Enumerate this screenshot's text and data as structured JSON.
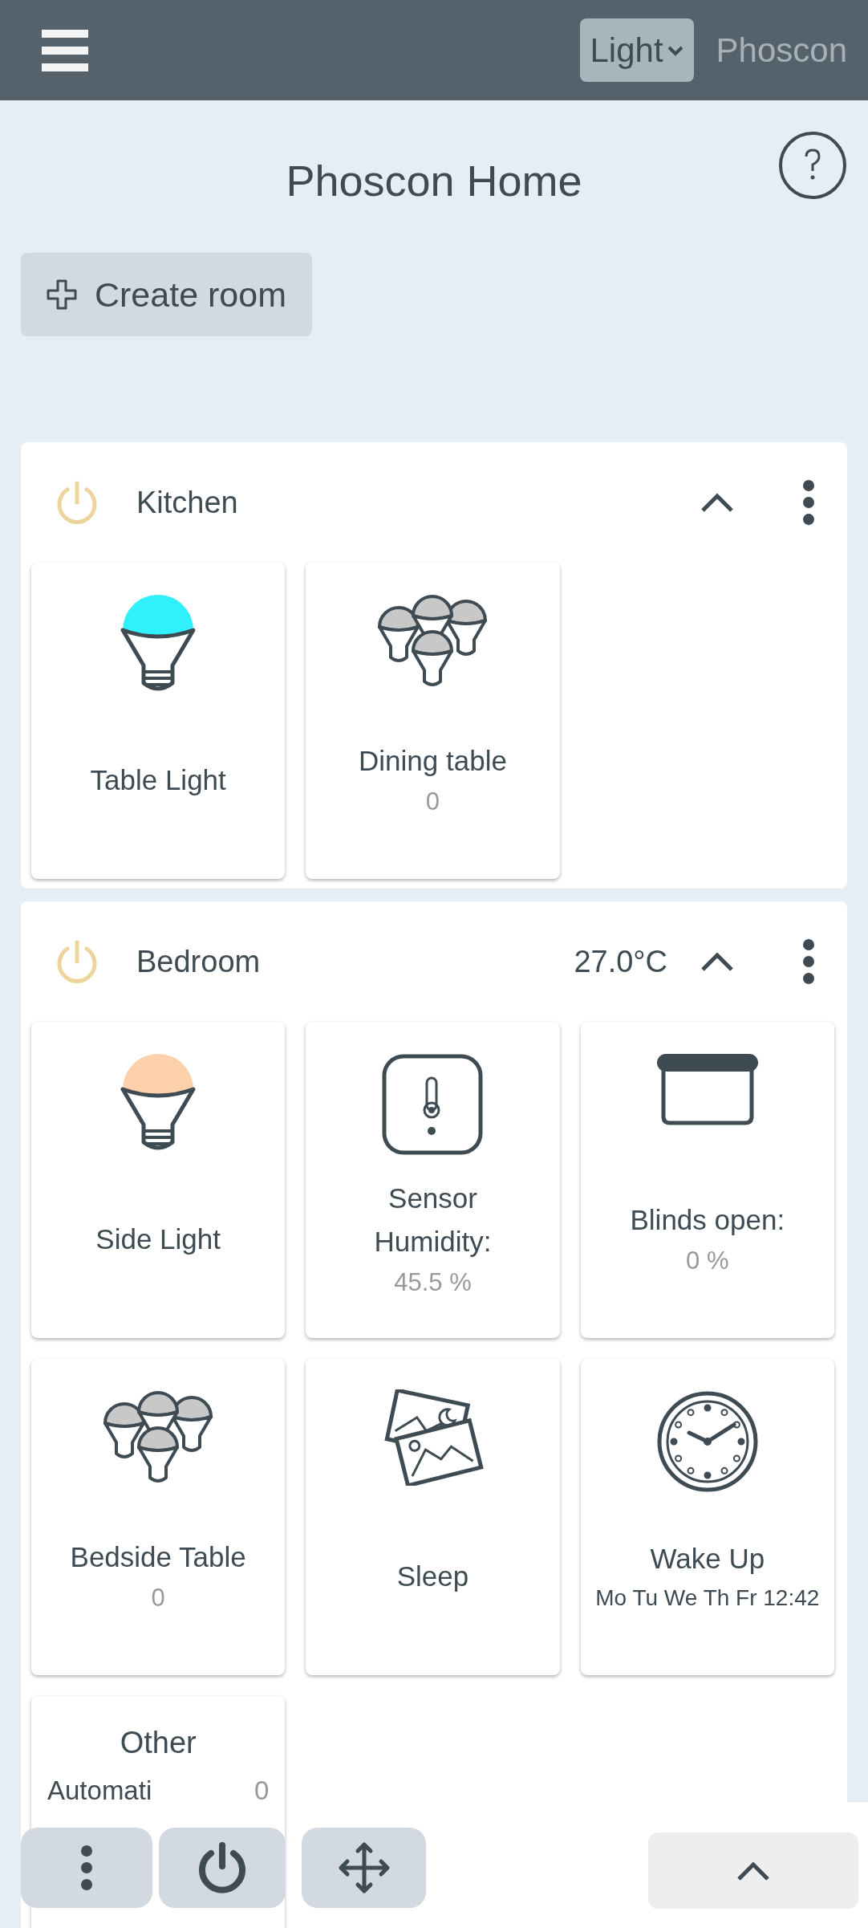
{
  "top_bar": {
    "theme_select": "Light",
    "brand": "Phoscon"
  },
  "title": "Phoscon Home",
  "create_button": "Create room",
  "rooms": [
    {
      "name": "Kitchen",
      "on": false,
      "expanded": true,
      "tiles": [
        {
          "kind": "light",
          "name": "Table Light",
          "color": "#2ff0fb"
        },
        {
          "kind": "group",
          "name": "Dining table",
          "value": "0"
        }
      ]
    },
    {
      "name": "Bedroom",
      "on": false,
      "temperature": "27.0°C",
      "expanded": true,
      "tiles": [
        {
          "kind": "light",
          "name": "Side Light",
          "color": "#fdd0ac"
        },
        {
          "kind": "sensor",
          "name": "Sensor Humidity:",
          "value": "45.5 %"
        },
        {
          "kind": "blinds",
          "name": "Blinds open:",
          "value": "0 %"
        },
        {
          "kind": "group",
          "name": "Bedside Table",
          "value": "0"
        },
        {
          "kind": "scene",
          "name": "Sleep"
        },
        {
          "kind": "schedule",
          "name": "Wake Up",
          "value": "Mo Tu We Th Fr 12:42"
        },
        {
          "kind": "other",
          "name": "Other",
          "rows": [
            {
              "label": "Automati",
              "value": "0"
            }
          ]
        }
      ]
    }
  ]
}
